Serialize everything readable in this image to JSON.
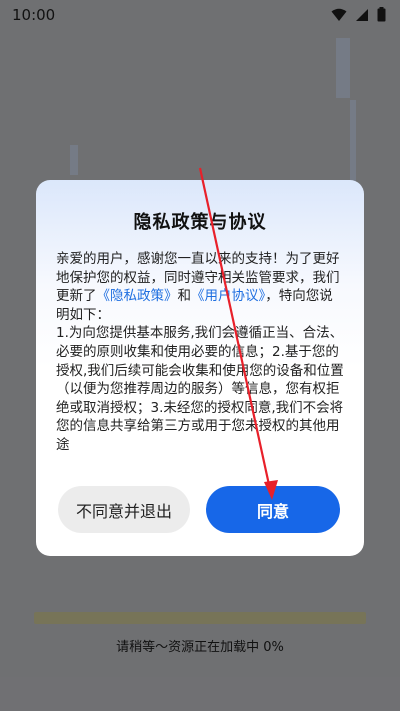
{
  "status_bar": {
    "time": "10:00",
    "icons": [
      "wifi-icon",
      "signal-icon",
      "battery-icon"
    ]
  },
  "dialog": {
    "title": "隐私政策与协议",
    "body": {
      "intro_before": "亲爱的用户，感谢您一直以来的支持！为了更好地保护您的权益，同时遵守相关监管要求，我们更新了",
      "privacy_link": "《隐私政策》",
      "and": "和",
      "user_link": "《用户协议》",
      "intro_after": "，特向您说明如下：",
      "item1": "1.为向您提供基本服务,我们会遵循正当、合法、必要的原则收集和使用必要的信息；",
      "item2": "2.基于您的授权,我们后续可能会收集和使用您的设备和位置（以便为您推荐周边的服务）等信息，您有权拒绝或取消授权；",
      "item3": "3.未经您的授权同意,我们不会将您的信息共享给第三方或用于您未授权的其他用途"
    },
    "decline_label": "不同意并退出",
    "agree_label": "同意"
  },
  "loading": {
    "text": "请稍等～资源正在加载中 0%",
    "progress": 0
  },
  "colors": {
    "accent": "#1767e8",
    "link": "#1f6fe0",
    "overlay": "#6f7072",
    "annotation_arrow": "#e8202a"
  }
}
